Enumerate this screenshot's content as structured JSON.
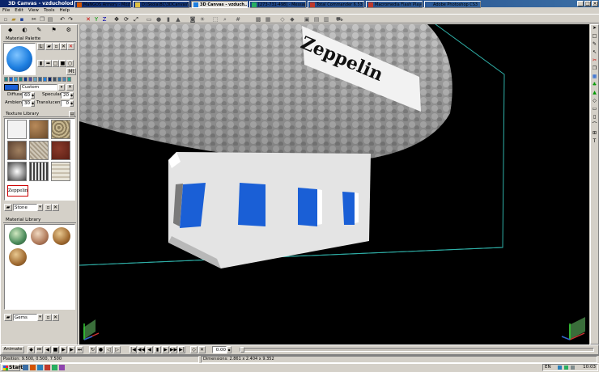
{
  "window": {
    "title": "3D Canvas - vzducholod"
  },
  "menu": [
    "File",
    "Edit",
    "View",
    "Tools",
    "Help"
  ],
  "material_palette": {
    "header": "Material Palette",
    "preset": "Custom",
    "diffuse_label": "Diffuse",
    "diffuse": "60",
    "specular_label": "Specular",
    "specular": "20",
    "ambient_label": "Ambient",
    "ambient": "30",
    "translucent_label": "Translucent",
    "translucent": "0",
    "side_button": "Mt"
  },
  "texture_library": {
    "header": "Texture Library",
    "selected_texture": "Zeppelin",
    "category": "Stone"
  },
  "material_library": {
    "header": "Material Library",
    "category": "Gems"
  },
  "scene": {
    "sign_text": "Zeppelin"
  },
  "status": {
    "animate_label": "Animate",
    "frame": "0.00",
    "position": "Position: 9.500, 0.500, 7.500",
    "dimensions": "Dimensions: 2.861 x 2.404 x 9.352"
  },
  "taskbar": {
    "start": "Start",
    "tasks": [
      "MaNGOS Armory - Mozilla ...",
      "D:\\Skola\\BC\\3DCanvas\\...",
      "3D Canvas - vzduch...",
      "[273-731-498] - Messagin...",
      "Total Commander 6.53 - F...",
      "Macromedia Flash Player 8",
      "Adobe Photoshop CS3"
    ],
    "lang": "EN",
    "clock": "10:03"
  },
  "colors": {
    "accent": "#0a246a",
    "material_blue": "#1e7fe0",
    "window_blue": "#1a5fd6",
    "sky": "#000000",
    "bbox": "#2fb0a8"
  },
  "icons": [
    "close-icon",
    "minimize-icon",
    "maximize-icon",
    "start-logo-icon",
    "arrow-icon"
  ]
}
